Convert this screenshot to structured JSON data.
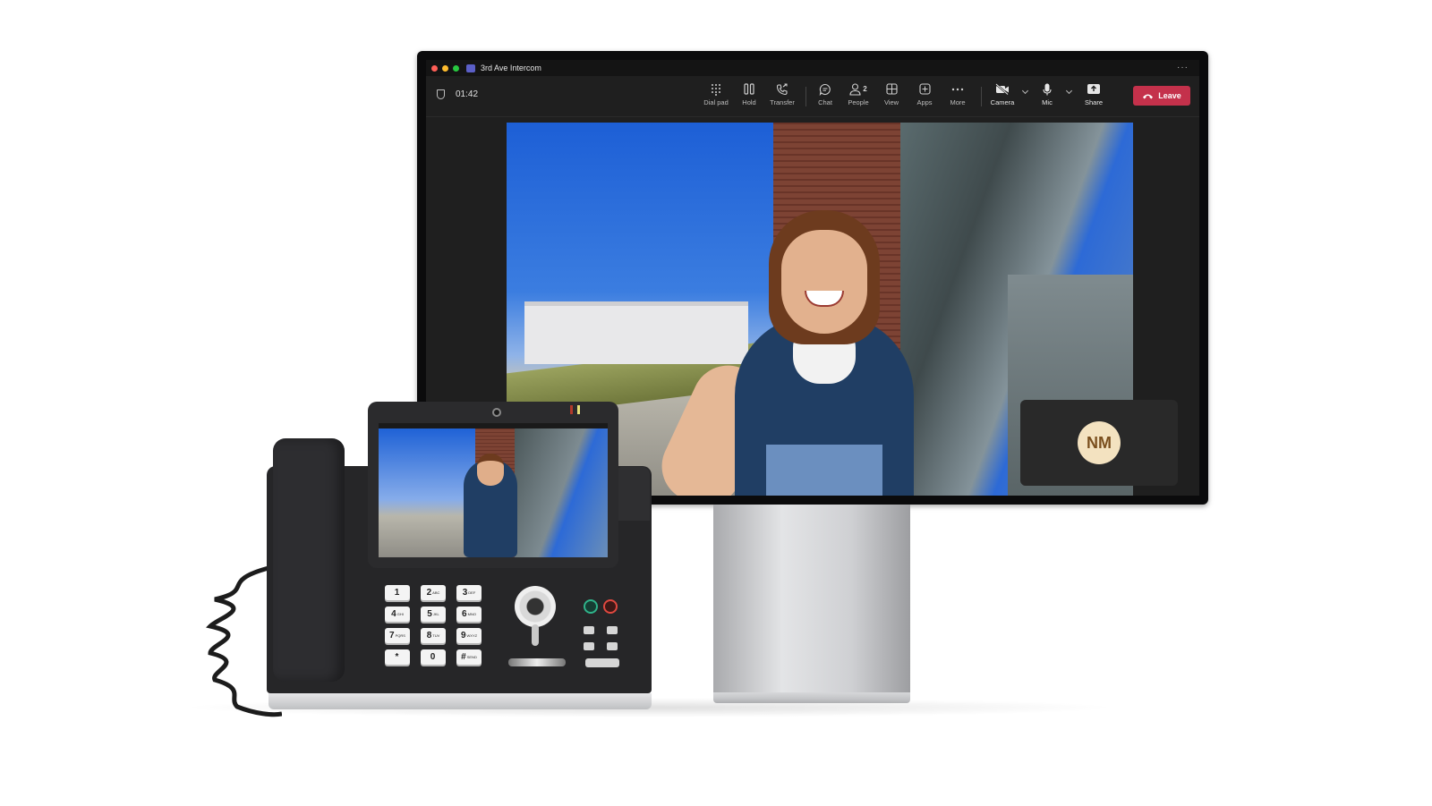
{
  "window": {
    "title": "3rd Ave Intercom",
    "more": "···"
  },
  "call": {
    "timer": "01:42"
  },
  "toolbar": {
    "dial_pad": "Dial pad",
    "hold": "Hold",
    "transfer": "Transfer",
    "chat": "Chat",
    "people": "People",
    "people_count": "2",
    "view": "View",
    "apps": "Apps",
    "more": "More",
    "camera": "Camera",
    "mic": "Mic",
    "share": "Share",
    "leave": "Leave"
  },
  "self_tile": {
    "initials": "NM"
  },
  "keypad": {
    "keys": [
      {
        "digit": "1",
        "letters": ""
      },
      {
        "digit": "2",
        "letters": "ABC"
      },
      {
        "digit": "3",
        "letters": "DEF"
      },
      {
        "digit": "4",
        "letters": "GHI"
      },
      {
        "digit": "5",
        "letters": "JKL"
      },
      {
        "digit": "6",
        "letters": "MNO"
      },
      {
        "digit": "7",
        "letters": "PQRS"
      },
      {
        "digit": "8",
        "letters": "TUV"
      },
      {
        "digit": "9",
        "letters": "WXYZ"
      },
      {
        "digit": "*",
        "letters": ""
      },
      {
        "digit": "0",
        "letters": ""
      },
      {
        "digit": "#",
        "letters": "SEND"
      }
    ]
  },
  "colors": {
    "leave": "#c4314b",
    "toolbar_bg": "#1f1f1f",
    "avatar_bg": "#f3e2c0",
    "headset_button": "#2fb38a",
    "mute_button": "#e0483f",
    "traffic_red": "#ff5f57",
    "traffic_yellow": "#febc2e",
    "traffic_green": "#28c840"
  }
}
